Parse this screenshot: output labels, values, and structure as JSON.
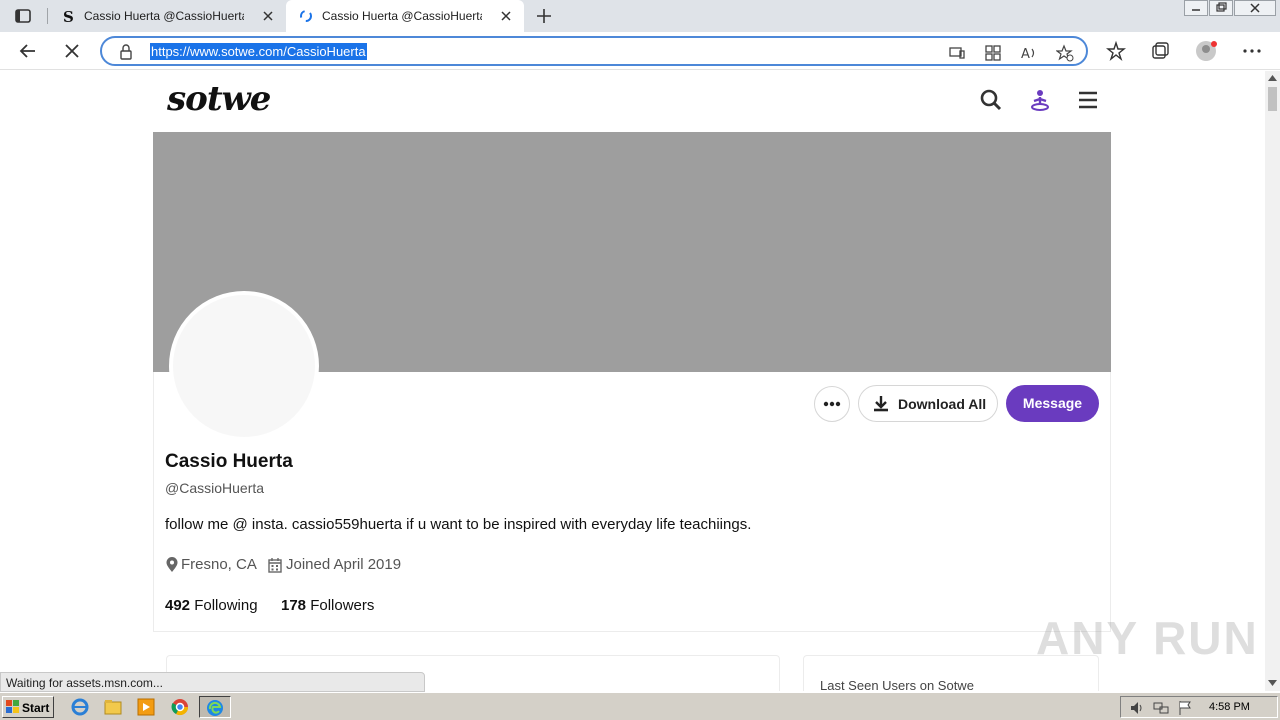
{
  "browser": {
    "tabs": [
      {
        "title": "Cassio Huerta @CassioHuerta - T"
      },
      {
        "title": "Cassio Huerta @CassioHuerta - T"
      }
    ],
    "url": "https://www.sotwe.com/CassioHuerta",
    "status_text": "Waiting for assets.msn.com..."
  },
  "site": {
    "logo": "sotwe",
    "accent_color": "#6a3bbf"
  },
  "profile": {
    "name": "Cassio Huerta",
    "handle": "@CassioHuerta",
    "bio": "follow me @ insta. cassio559huerta if u want to be inspired with everyday life teachiings.",
    "location": "Fresno, CA",
    "joined": "Joined April 2019",
    "following_count": "492",
    "following_label": "Following",
    "followers_count": "178",
    "followers_label": "Followers",
    "download_label": "Download All",
    "message_label": "Message"
  },
  "sidebar": {
    "last_seen_title": "Last Seen Users on Sotwe"
  },
  "watermark": "ANY RUN",
  "taskbar": {
    "start_label": "Start",
    "clock": "4:58 PM"
  }
}
